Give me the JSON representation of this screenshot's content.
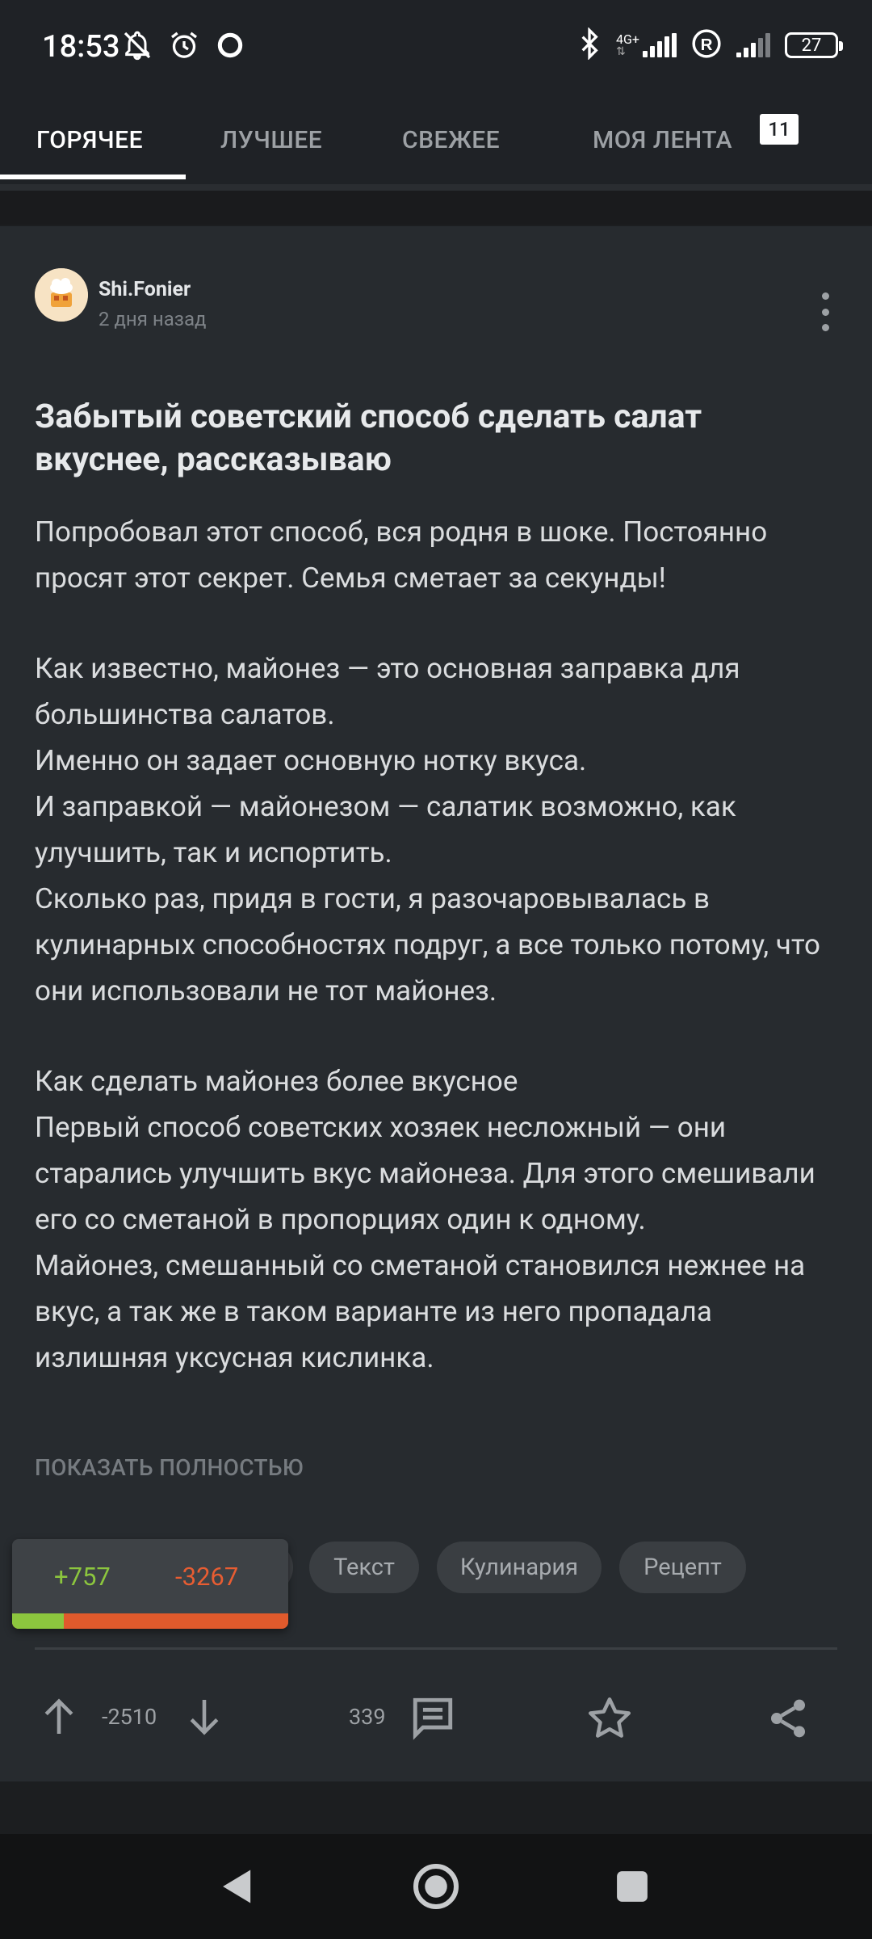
{
  "status_bar": {
    "time": "18:53",
    "network_label": "4G+",
    "battery_level": "27",
    "icons": [
      "notifications-off-icon",
      "alarm-icon",
      "circle-icon",
      "bluetooth-icon",
      "signal-icon",
      "registered-icon",
      "wifi-signal-icon",
      "battery-icon"
    ]
  },
  "tabs": [
    {
      "label": "ГОРЯЧЕЕ",
      "active": true
    },
    {
      "label": "ЛУЧШЕЕ",
      "active": false
    },
    {
      "label": "СВЕЖЕЕ",
      "active": false
    },
    {
      "label": "МОЯ ЛЕНТА",
      "active": false,
      "badge": "11"
    }
  ],
  "post": {
    "author": "Shi.Fonier",
    "time": "2 дня назад",
    "title": "Забытый советский способ сделать салат вкуснее, рассказываю",
    "paragraphs": [
      "Попробовал этот способ, вся родня в шоке. Постоянно просят этот секрет. Семья сметает за секунды!",
      "Как известно, майонез — это основная заправка для большинства салатов.",
      "Именно он задает основную нотку вкуса.",
      "И заправкой — майонезом — салатик возможно, как улучшить, так и испортить.",
      "Сколько раз, придя в гости, я разочаровывалась в кулинарных способностях подруг, а все только потому, что они использовали не тот майонез.",
      "Как сделать майонез более вкусное",
      "Первый способ советских хозяек несложный — они старались улучшить вкус майонеза. Для этого смешивали его со сметаной в пропорциях один к одному.",
      "Майонез, смешанный со сметаной становился нежнее на вкус, а так же в таком варианте из него пропадала излишняя уксусная кислинка."
    ],
    "show_full_label": "ПОКАЗАТЬ ПОЛНОСТЬЮ",
    "tags": [
      "Текст",
      "Кулинария",
      "Рецепт"
    ],
    "rating_popup": {
      "plus": "+757",
      "minus": "-3267",
      "plus_fraction": 0.188
    },
    "rating": "-2510",
    "comments": "339"
  },
  "colors": {
    "background": "#1c1e20",
    "card": "#272b2f",
    "positive": "#8cc63e",
    "negative": "#e85d32"
  }
}
